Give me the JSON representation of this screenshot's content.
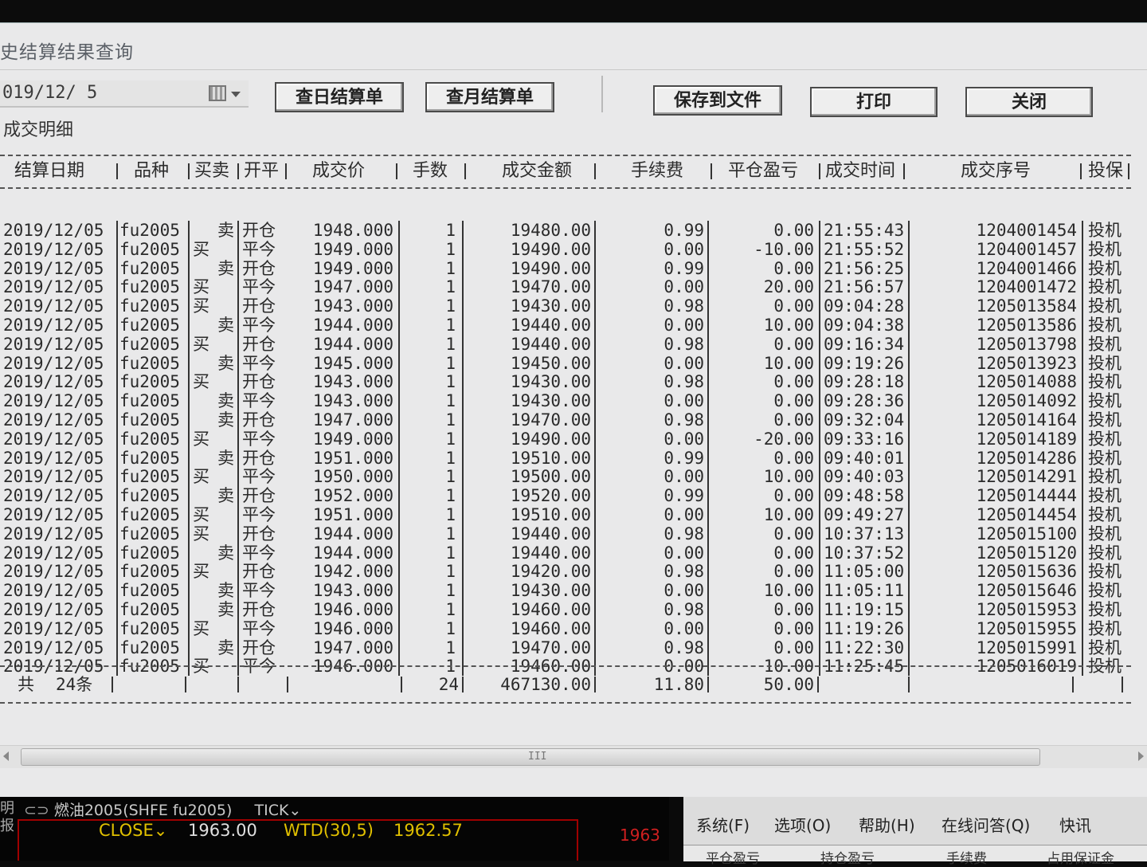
{
  "window": {
    "title": "史结算结果查询"
  },
  "toolbar": {
    "date_value": "019/12/ 5",
    "daily_btn": "查日结算单",
    "monthly_btn": "查月结算单",
    "save_btn": "保存到文件",
    "print_btn": "打印",
    "close_btn": "关闭"
  },
  "section": {
    "label": "成交明细"
  },
  "table": {
    "headers": [
      "结算日期",
      "品种",
      "买卖",
      "开平",
      "成交价",
      "手数",
      "成交金额",
      "手续费",
      "平仓盈亏",
      "成交时间",
      "成交序号",
      "投保"
    ],
    "rows": [
      [
        "2019/12/05",
        "fu2005",
        "卖",
        "开仓",
        "1948.000",
        "1",
        "19480.00",
        "0.99",
        "0.00",
        "21:55:43",
        "1204001454",
        "投机"
      ],
      [
        "2019/12/05",
        "fu2005",
        "买",
        "平今",
        "1949.000",
        "1",
        "19490.00",
        "0.00",
        "-10.00",
        "21:55:52",
        "1204001457",
        "投机"
      ],
      [
        "2019/12/05",
        "fu2005",
        "卖",
        "开仓",
        "1949.000",
        "1",
        "19490.00",
        "0.99",
        "0.00",
        "21:56:25",
        "1204001466",
        "投机"
      ],
      [
        "2019/12/05",
        "fu2005",
        "买",
        "平今",
        "1947.000",
        "1",
        "19470.00",
        "0.00",
        "20.00",
        "21:56:57",
        "1204001472",
        "投机"
      ],
      [
        "2019/12/05",
        "fu2005",
        "买",
        "开仓",
        "1943.000",
        "1",
        "19430.00",
        "0.98",
        "0.00",
        "09:04:28",
        "1205013584",
        "投机"
      ],
      [
        "2019/12/05",
        "fu2005",
        "卖",
        "平今",
        "1944.000",
        "1",
        "19440.00",
        "0.00",
        "10.00",
        "09:04:38",
        "1205013586",
        "投机"
      ],
      [
        "2019/12/05",
        "fu2005",
        "买",
        "开仓",
        "1944.000",
        "1",
        "19440.00",
        "0.98",
        "0.00",
        "09:16:34",
        "1205013798",
        "投机"
      ],
      [
        "2019/12/05",
        "fu2005",
        "卖",
        "平今",
        "1945.000",
        "1",
        "19450.00",
        "0.00",
        "10.00",
        "09:19:26",
        "1205013923",
        "投机"
      ],
      [
        "2019/12/05",
        "fu2005",
        "买",
        "开仓",
        "1943.000",
        "1",
        "19430.00",
        "0.98",
        "0.00",
        "09:28:18",
        "1205014088",
        "投机"
      ],
      [
        "2019/12/05",
        "fu2005",
        "卖",
        "平今",
        "1943.000",
        "1",
        "19430.00",
        "0.00",
        "0.00",
        "09:28:36",
        "1205014092",
        "投机"
      ],
      [
        "2019/12/05",
        "fu2005",
        "卖",
        "开仓",
        "1947.000",
        "1",
        "19470.00",
        "0.98",
        "0.00",
        "09:32:04",
        "1205014164",
        "投机"
      ],
      [
        "2019/12/05",
        "fu2005",
        "买",
        "平今",
        "1949.000",
        "1",
        "19490.00",
        "0.00",
        "-20.00",
        "09:33:16",
        "1205014189",
        "投机"
      ],
      [
        "2019/12/05",
        "fu2005",
        "卖",
        "开仓",
        "1951.000",
        "1",
        "19510.00",
        "0.99",
        "0.00",
        "09:40:01",
        "1205014286",
        "投机"
      ],
      [
        "2019/12/05",
        "fu2005",
        "买",
        "平今",
        "1950.000",
        "1",
        "19500.00",
        "0.00",
        "10.00",
        "09:40:03",
        "1205014291",
        "投机"
      ],
      [
        "2019/12/05",
        "fu2005",
        "卖",
        "开仓",
        "1952.000",
        "1",
        "19520.00",
        "0.99",
        "0.00",
        "09:48:58",
        "1205014444",
        "投机"
      ],
      [
        "2019/12/05",
        "fu2005",
        "买",
        "平今",
        "1951.000",
        "1",
        "19510.00",
        "0.00",
        "10.00",
        "09:49:27",
        "1205014454",
        "投机"
      ],
      [
        "2019/12/05",
        "fu2005",
        "买",
        "开仓",
        "1944.000",
        "1",
        "19440.00",
        "0.98",
        "0.00",
        "10:37:13",
        "1205015100",
        "投机"
      ],
      [
        "2019/12/05",
        "fu2005",
        "卖",
        "平今",
        "1944.000",
        "1",
        "19440.00",
        "0.00",
        "0.00",
        "10:37:52",
        "1205015120",
        "投机"
      ],
      [
        "2019/12/05",
        "fu2005",
        "买",
        "开仓",
        "1942.000",
        "1",
        "19420.00",
        "0.98",
        "0.00",
        "11:05:00",
        "1205015636",
        "投机"
      ],
      [
        "2019/12/05",
        "fu2005",
        "卖",
        "平今",
        "1943.000",
        "1",
        "19430.00",
        "0.00",
        "10.00",
        "11:05:11",
        "1205015646",
        "投机"
      ],
      [
        "2019/12/05",
        "fu2005",
        "卖",
        "开仓",
        "1946.000",
        "1",
        "19460.00",
        "0.98",
        "0.00",
        "11:19:15",
        "1205015953",
        "投机"
      ],
      [
        "2019/12/05",
        "fu2005",
        "买",
        "平今",
        "1946.000",
        "1",
        "19460.00",
        "0.00",
        "0.00",
        "11:19:26",
        "1205015955",
        "投机"
      ],
      [
        "2019/12/05",
        "fu2005",
        "卖",
        "开仓",
        "1947.000",
        "1",
        "19470.00",
        "0.98",
        "0.00",
        "11:22:30",
        "1205015991",
        "投机"
      ],
      [
        "2019/12/05",
        "fu2005",
        "买",
        "平今",
        "1946.000",
        "1",
        "19460.00",
        "0.00",
        "10.00",
        "11:25:45",
        "1205016019",
        "投机"
      ]
    ],
    "footer": {
      "total_label": "共",
      "count": "24条",
      "lots": "24",
      "amount": "467130.00",
      "fee": "11.80",
      "pnl": "50.00"
    }
  },
  "scroll": {
    "grip": "III"
  },
  "quote": {
    "left_cut_top": "明",
    "left_cut_bottom": "报",
    "title": "燃油2005(SHFE  fu2005)",
    "mode": "TICK",
    "close_label": "CLOSE",
    "close_value": "1963.00",
    "wtd_label": "WTD(30,5)",
    "wtd_value": "1962.57",
    "price": "1963"
  },
  "menu": {
    "items": [
      "系统(F)",
      "选项(O)",
      "帮助(H)",
      "在线问答(Q)",
      "快讯"
    ],
    "sub_items": [
      "平仓盈亏",
      "持仓盈亏",
      "手续费",
      "占用保证金"
    ]
  },
  "colors": {
    "window_bg": "#e9e9ea",
    "quote_red": "#a00000",
    "quote_yellow": "#e1c000"
  }
}
